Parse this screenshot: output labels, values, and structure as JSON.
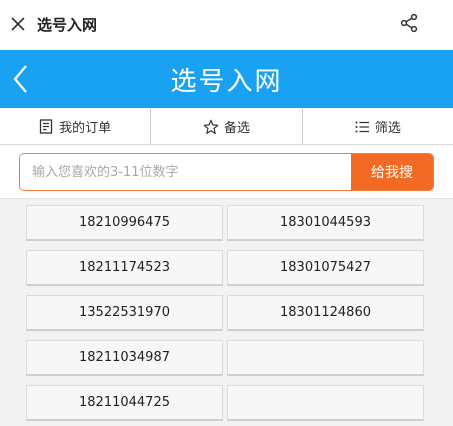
{
  "topbar": {
    "title": "选号入网"
  },
  "header": {
    "title": "选号入网"
  },
  "tabs": [
    {
      "label": "我的订单",
      "icon": "order-list-icon"
    },
    {
      "label": "备选",
      "icon": "star-icon"
    },
    {
      "label": "筛选",
      "icon": "list-filter-icon"
    }
  ],
  "search": {
    "placeholder": "输入您喜欢的3-11位数字",
    "value": "",
    "button_label": "给我搜"
  },
  "numbers": {
    "left": [
      "18210996475",
      "18211174523",
      "13522531970",
      "18211034987",
      "18211044725"
    ],
    "right": [
      "18301044593",
      "18301075427",
      "18301124860",
      "",
      ""
    ]
  },
  "colors": {
    "header_blue": "#1aa2f2",
    "search_orange": "#f26a23",
    "search_border": "#f07a3c"
  }
}
